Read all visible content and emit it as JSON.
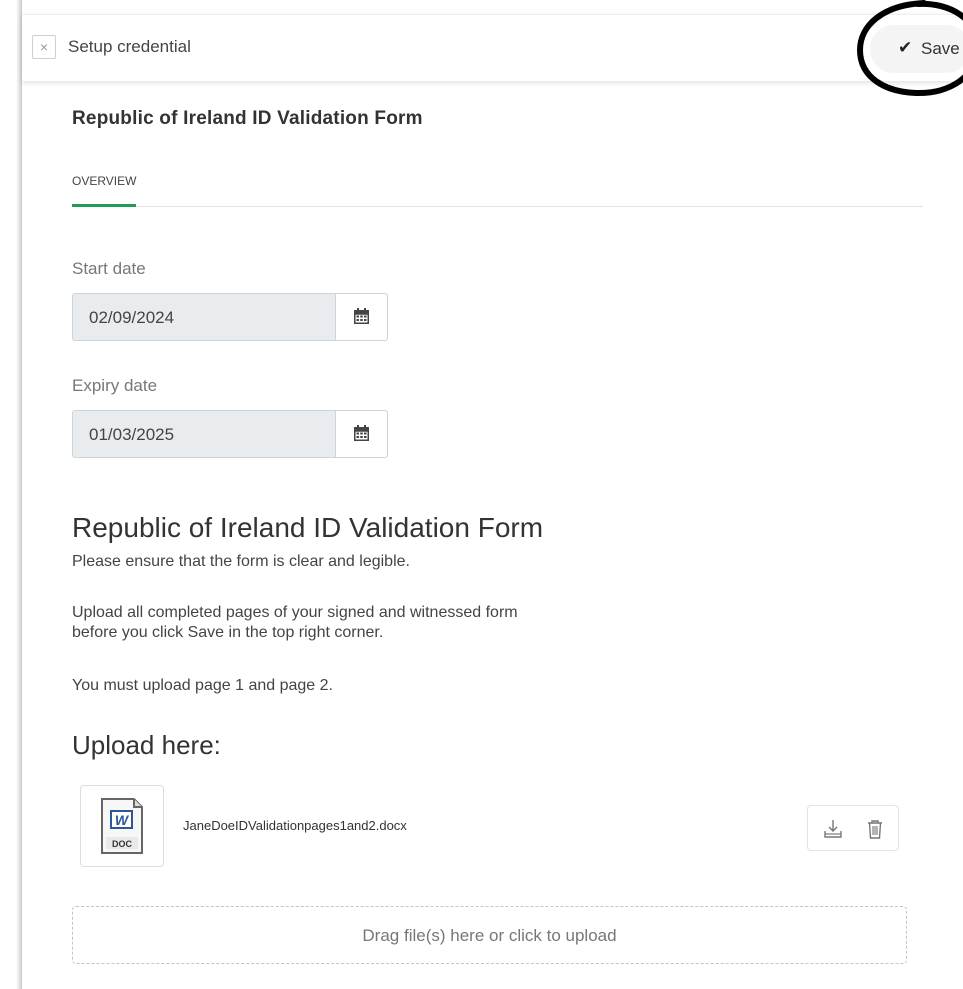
{
  "topbar": {
    "close_label": "×",
    "title": "Setup credential",
    "save_label": "Save",
    "save_check": "✔"
  },
  "form": {
    "title": "Republic of Ireland ID Validation Form"
  },
  "tabs": [
    {
      "label": "OVERVIEW",
      "active": true
    }
  ],
  "fields": {
    "start_date": {
      "label": "Start date",
      "value": "02/09/2024"
    },
    "expiry_date": {
      "label": "Expiry date",
      "value": "01/03/2025"
    }
  },
  "instructions": {
    "heading": "Republic of Ireland ID Validation Form",
    "line1": "Please ensure that the form is clear and legible.",
    "line2a": "Upload all completed pages of your signed and witnessed form",
    "line2b": "before you click Save in the top right corner.",
    "line3": "You must upload page 1 and page 2."
  },
  "upload": {
    "heading": "Upload here:",
    "files": [
      {
        "name": "JaneDoeIDValidationpages1and2.docx",
        "type_label": "DOC",
        "icon_letter": "W"
      }
    ],
    "dropzone_text": "Drag file(s) here or click to upload"
  },
  "colors": {
    "accent_tab": "#1f9d55",
    "word_blue": "#2b579a",
    "annotation_ring": "#000000"
  }
}
